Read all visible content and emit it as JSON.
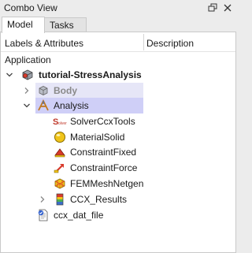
{
  "window": {
    "title": "Combo View"
  },
  "tabs": [
    {
      "label": "Model"
    },
    {
      "label": "Tasks"
    }
  ],
  "header": {
    "labels_col": "Labels & Attributes",
    "description_col": "Description"
  },
  "tree": {
    "section_label": "Application",
    "items": [
      {
        "label": "tutorial-StressAnalysis",
        "icon": "document-icon"
      },
      {
        "label": "Body",
        "icon": "body-icon"
      },
      {
        "label": "Analysis",
        "icon": "analysis-icon"
      },
      {
        "label": "SolverCcxTools",
        "icon": "solver-icon"
      },
      {
        "label": "MaterialSolid",
        "icon": "material-icon"
      },
      {
        "label": "ConstraintFixed",
        "icon": "constraint-fixed-icon"
      },
      {
        "label": "ConstraintForce",
        "icon": "constraint-force-icon"
      },
      {
        "label": "FEMMeshNetgen",
        "icon": "mesh-icon"
      },
      {
        "label": "CCX_Results",
        "icon": "results-icon"
      },
      {
        "label": "ccx_dat_file",
        "icon": "text-file-icon"
      }
    ]
  },
  "colors": {
    "selection": "#cfcff7",
    "panel_bg": "#ffffff",
    "window_bg": "#ececec"
  }
}
